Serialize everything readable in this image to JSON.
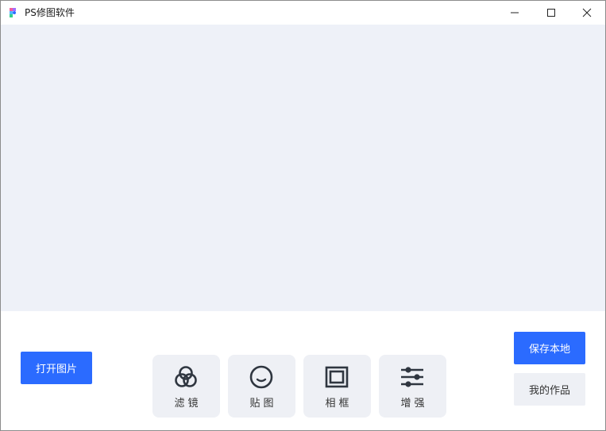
{
  "window": {
    "title": "PS修图软件",
    "controls": {
      "minimize": "minimize-icon",
      "maximize": "maximize-icon",
      "close": "close-icon"
    }
  },
  "canvas": {
    "background": "#eef1f8"
  },
  "actions": {
    "open_label": "打开图片",
    "save_label": "保存本地",
    "works_label": "我的作品"
  },
  "tools": [
    {
      "label": "滤镜",
      "icon": "filter-circles-icon"
    },
    {
      "label": "贴图",
      "icon": "sticker-face-icon"
    },
    {
      "label": "相框",
      "icon": "frame-icon"
    },
    {
      "label": "增强",
      "icon": "sliders-icon"
    }
  ],
  "colors": {
    "accent": "#2b6bff",
    "tool_bg": "#eef0f5",
    "text": "#333333"
  }
}
